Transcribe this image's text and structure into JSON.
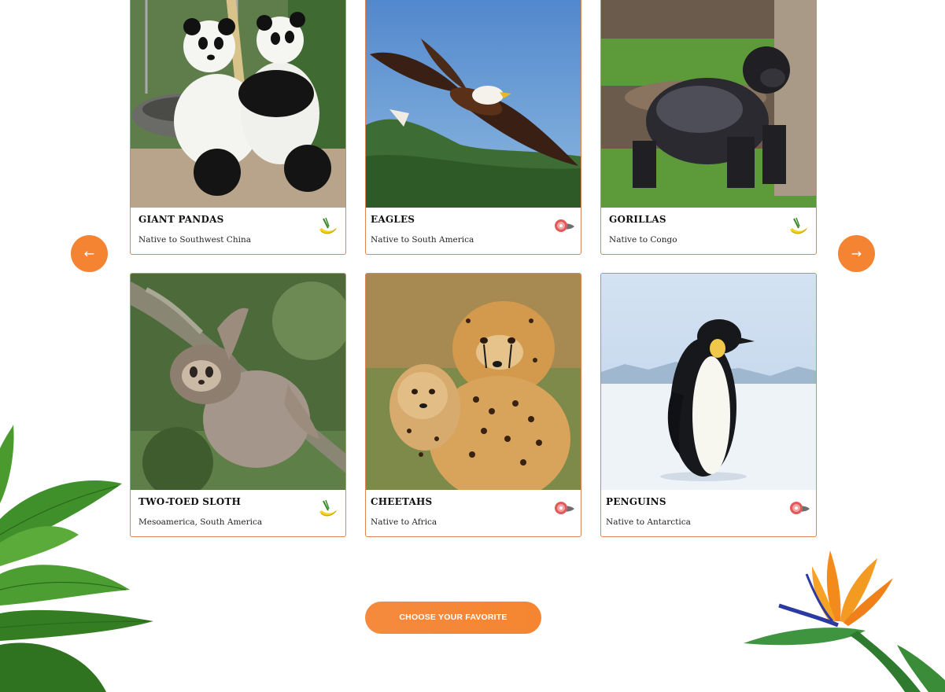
{
  "navigation": {
    "prev_label": "←",
    "next_label": "→"
  },
  "animals": [
    {
      "name": "GIANT PANDAS",
      "origin": "Native to Southwest China",
      "diet_icon": "banana-icon"
    },
    {
      "name": "EAGLES",
      "origin": "Native to South America",
      "diet_icon": "meat-fish-icon"
    },
    {
      "name": "GORILLAS",
      "origin": "Native to Congo",
      "diet_icon": "banana-icon"
    },
    {
      "name": "TWO-TOED SLOTH",
      "origin": "Mesoamerica, South America",
      "diet_icon": "banana-icon"
    },
    {
      "name": "CHEETAHS",
      "origin": "Native to Africa",
      "diet_icon": "meat-fish-icon"
    },
    {
      "name": "PENGUINS",
      "origin": "Native to Antarctica",
      "diet_icon": "meat-fish-icon"
    }
  ],
  "cta": {
    "label": "CHOOSE YOUR FAVORITE"
  },
  "colors": {
    "accent": "#f48432",
    "card_border": "#e1844f"
  }
}
